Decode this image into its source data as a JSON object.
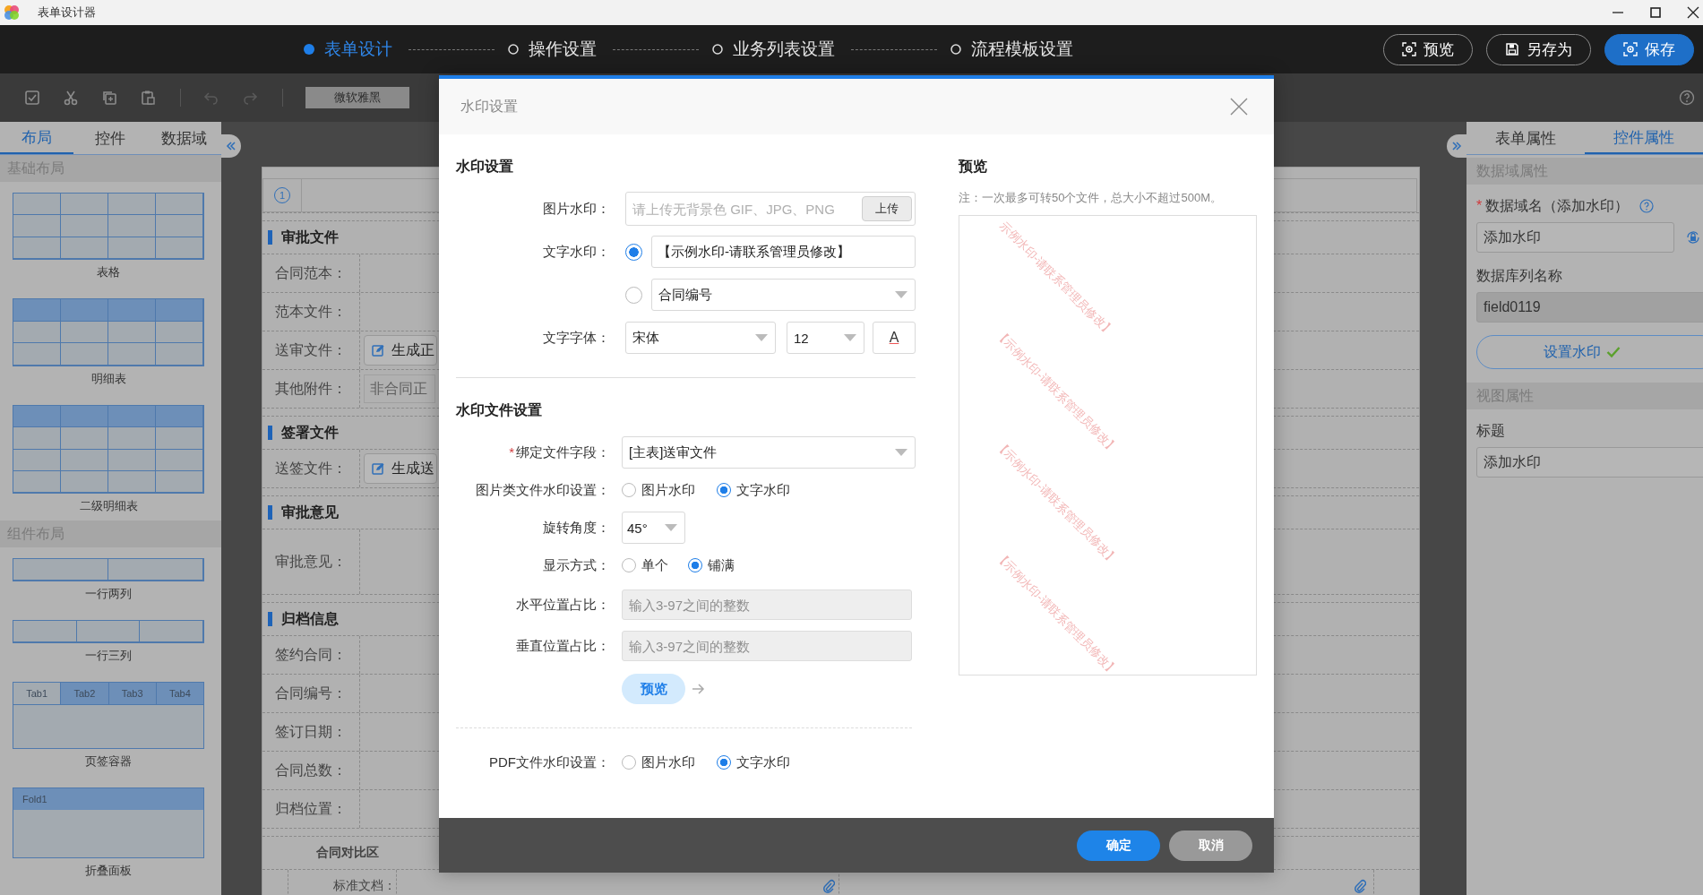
{
  "app": {
    "title": "表单设计器"
  },
  "steps": [
    {
      "label": "表单设计",
      "selected": true
    },
    {
      "label": "操作设置",
      "selected": false
    },
    {
      "label": "业务列表设置",
      "selected": false
    },
    {
      "label": "流程模板设置",
      "selected": false
    }
  ],
  "header_buttons": [
    {
      "label": "预览",
      "kind": "preview"
    },
    {
      "label": "另存为",
      "kind": "saveas"
    },
    {
      "label": "保存",
      "kind": "save"
    }
  ],
  "toolbar": {
    "font": "微软雅黑"
  },
  "left_panel": {
    "tabs": [
      {
        "label": "布局",
        "selected": true
      },
      {
        "label": "控件",
        "selected": false
      },
      {
        "label": "数据域",
        "selected": false
      }
    ],
    "groups": [
      {
        "title": "基础布局",
        "items": [
          {
            "label": "表格",
            "kind": "grid"
          },
          {
            "label": "明细表",
            "kind": "detail"
          },
          {
            "label": "二级明细表",
            "kind": "detail2"
          }
        ]
      },
      {
        "title": "组件布局",
        "items": [
          {
            "label": "一行两列",
            "kind": "cols2"
          },
          {
            "label": "一行三列",
            "kind": "cols3"
          },
          {
            "label": "页签容器",
            "kind": "tabs",
            "tabs": [
              "Tab1",
              "Tab2",
              "Tab3",
              "Tab4"
            ]
          },
          {
            "label": "折叠面板",
            "kind": "fold",
            "header": "Fold1"
          }
        ]
      }
    ]
  },
  "form_canvas": {
    "index": "1",
    "sections": [
      {
        "title": "审批文件",
        "rows": [
          {
            "label": "合同范本：",
            "kind": "blank"
          },
          {
            "label": "范本文件：",
            "kind": "blank"
          },
          {
            "label": "送审文件：",
            "kind": "action",
            "value": "生成正"
          },
          {
            "label": "其他附件：",
            "kind": "hint",
            "placeholder": "非合同正"
          }
        ]
      },
      {
        "title": "签署文件",
        "rows": [
          {
            "label": "送签文件：",
            "kind": "action",
            "value": "生成送"
          }
        ]
      },
      {
        "title": "审批意见",
        "rows": [
          {
            "label": "审批意见：",
            "kind": "tall"
          }
        ]
      },
      {
        "title": "归档信息",
        "rows": [
          {
            "label": "签约合同：",
            "kind": "blank"
          },
          {
            "label": "合同编号：",
            "kind": "blank"
          },
          {
            "label": "签订日期：",
            "kind": "blank"
          },
          {
            "label": "合同总数：",
            "kind": "blank"
          },
          {
            "label": "归档位置：",
            "kind": "blank"
          }
        ]
      }
    ],
    "compare": {
      "title": "合同对比区",
      "label": "标准文档："
    }
  },
  "right_panel": {
    "tabs": [
      {
        "label": "表单属性",
        "selected": false
      },
      {
        "label": "控件属性",
        "selected": true
      }
    ],
    "data_section": "数据域属性",
    "field_name": {
      "mark": "*",
      "label": "数据域名（添加水印）",
      "value": "添加水印"
    },
    "column_name": {
      "label": "数据库列名称",
      "value": "field0119"
    },
    "set_button": "设置水印",
    "view_section": "视图属性",
    "title_field": {
      "label": "标题",
      "value": "添加水印"
    }
  },
  "modal": {
    "title": "水印设置",
    "section1": "水印设置",
    "image_watermark": {
      "label": "图片水印：",
      "placeholder": "请上传无背景色 GIF、JPG、PNG",
      "button": "上传"
    },
    "text_watermark": {
      "label": "文字水印：",
      "options": [
        {
          "kind": "input",
          "value": "【示例水印-请联系管理员修改】",
          "selected": true
        },
        {
          "kind": "select",
          "value": "合同编号",
          "selected": false
        }
      ]
    },
    "font": {
      "label": "文字字体：",
      "family": "宋体",
      "size": "12",
      "color_button": "A"
    },
    "section2": "水印文件设置",
    "bind_field": {
      "mark": "*",
      "label": "绑定文件字段：",
      "value": "[主表]送审文件"
    },
    "image_files": {
      "label": "图片类文件水印设置：",
      "options": [
        {
          "label": "图片水印",
          "selected": false
        },
        {
          "label": "文字水印",
          "selected": true
        }
      ]
    },
    "rotation": {
      "label": "旋转角度：",
      "value": "45°"
    },
    "display_mode": {
      "label": "显示方式：",
      "options": [
        {
          "label": "单个",
          "selected": false
        },
        {
          "label": "铺满",
          "selected": true
        }
      ]
    },
    "horizontal": {
      "label": "水平位置占比：",
      "placeholder": "输入3-97之间的整数"
    },
    "vertical": {
      "label": "垂直位置占比：",
      "placeholder": "输入3-97之间的整数"
    },
    "preview_button": "预览",
    "pdf_files": {
      "label": "PDF文件水印设置：",
      "options": [
        {
          "label": "图片水印",
          "selected": false
        },
        {
          "label": "文字水印",
          "selected": true
        }
      ]
    },
    "preview": {
      "title": "预览",
      "note": "注：一次最多可转50个文件，总大小不超过500M。",
      "watermarks": [
        "示例水印-请联系管理员修改】",
        "【示例水印-请联系管理员修改】",
        "【示例水印-请联系管理员修改】",
        "【示例水印-请联系管理员修改】"
      ]
    },
    "buttons": [
      {
        "label": "确定",
        "kind": "primary"
      },
      {
        "label": "取消",
        "kind": "secondary"
      }
    ]
  }
}
